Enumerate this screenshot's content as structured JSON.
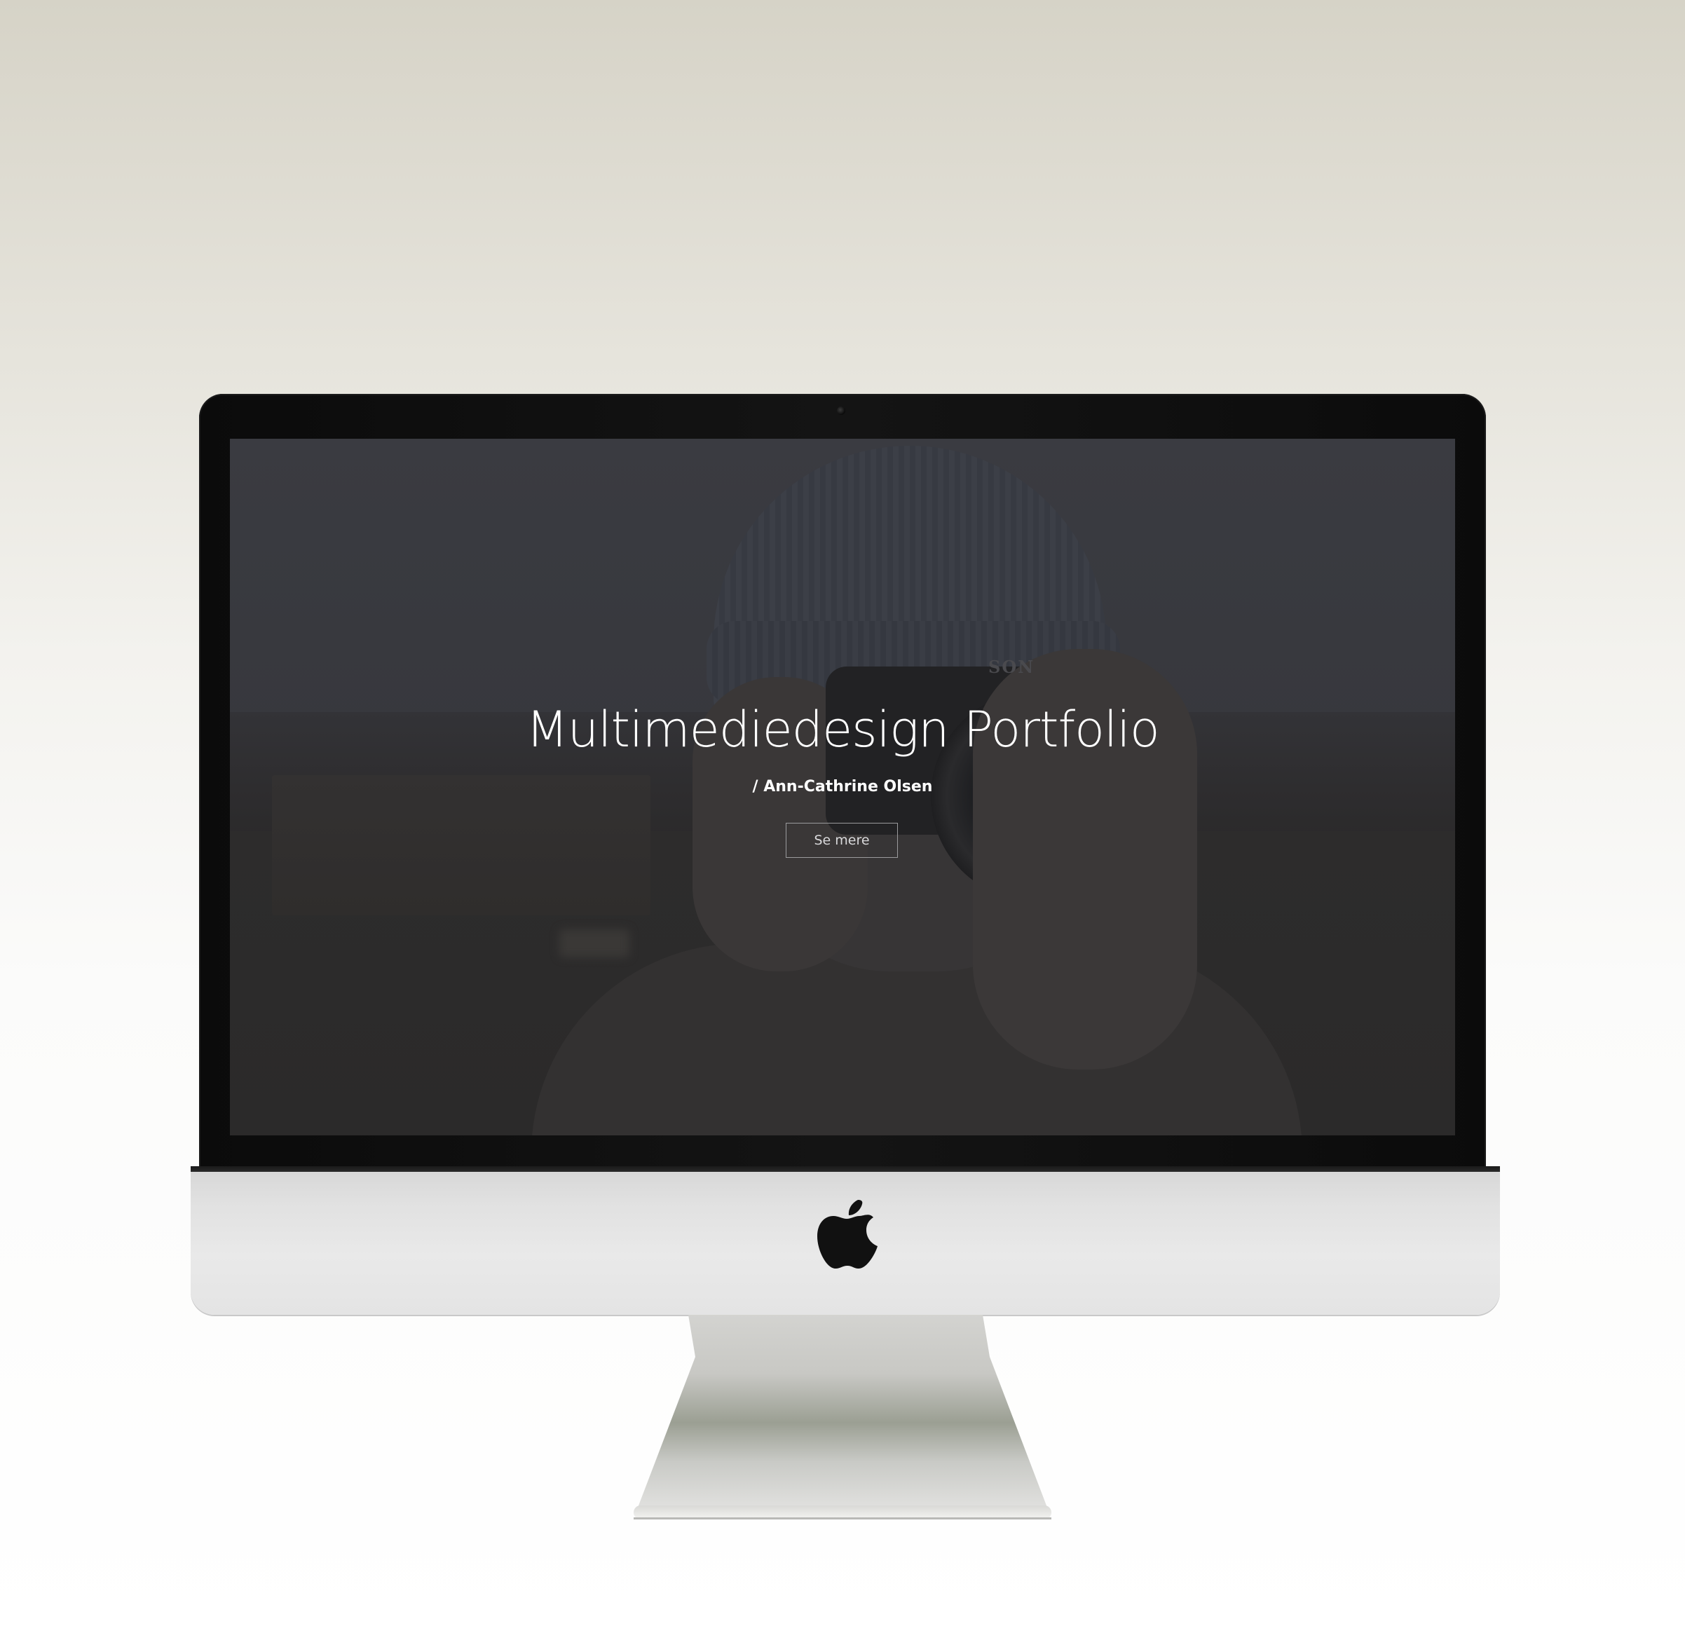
{
  "page": {
    "hero_title": "Multimediedesign Portfolio",
    "hero_subtitle": "/ Ann-Cathrine Olsen",
    "cta_label": "Se mere"
  },
  "photo": {
    "camera_brand": "SON"
  },
  "colors": {
    "overlay": "#2d2d31",
    "text": "#ffffff",
    "button_border": "#9b9b9d",
    "bezel": "#0b0b0b",
    "aluminum": "#e4e4e4"
  },
  "icons": {
    "logo": "apple-logo-icon",
    "camera": "webcam-icon"
  }
}
